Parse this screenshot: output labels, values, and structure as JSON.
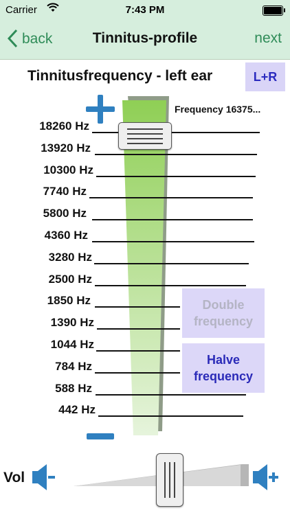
{
  "status_bar": {
    "carrier": "Carrier",
    "time": "7:43 PM"
  },
  "nav": {
    "back_label": "back",
    "title": "Tinnitus-profile",
    "next_label": "next"
  },
  "heading": "Tinnitusfrequency - left ear",
  "lr_button": "L+R",
  "frequency_readout": "Frequency 16375...",
  "frequencies": [
    "18260 Hz",
    "13920 Hz",
    "10300 Hz",
    "7740 Hz",
    "5800 Hz",
    "4360 Hz",
    "3280 Hz",
    "2500 Hz",
    "1850 Hz",
    "1390 Hz",
    "1044 Hz",
    "784 Hz",
    "588 Hz",
    "442 Hz"
  ],
  "buttons": {
    "double_line1": "Double",
    "double_line2": "frequency",
    "halve_line1": "Halve",
    "halve_line2": "frequency"
  },
  "volume": {
    "label": "Vol"
  },
  "colors": {
    "accent": "#2e8b57",
    "bar_blue": "#2f80c0",
    "button_bg": "#dcd7f8",
    "button_text": "#2a2ab8"
  }
}
